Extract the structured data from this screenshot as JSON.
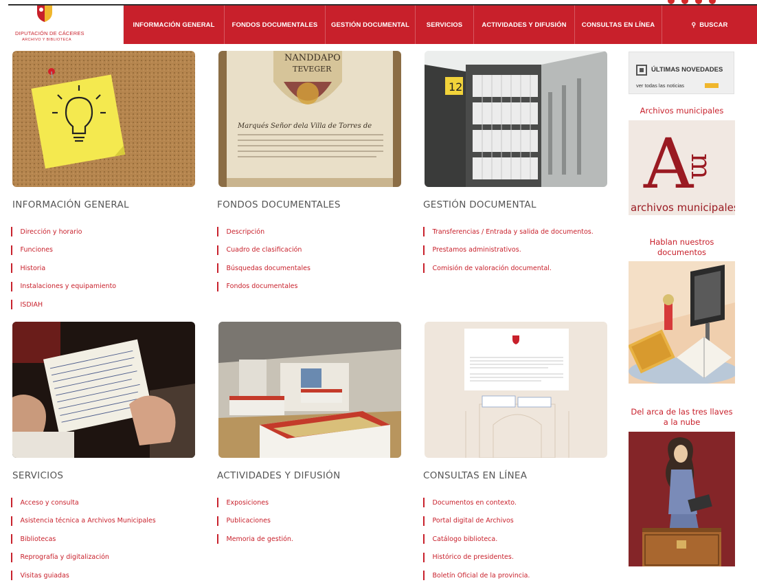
{
  "header": {
    "logo_line1": "DIPUTACIÓN DE CÁCERES",
    "logo_line2": "ARCHIVO Y BIBLIOTECA",
    "nav": [
      {
        "label": "INFORMACIÓN GENERAL",
        "width": 146
      },
      {
        "label": "FONDOS DOCUMENTALES",
        "width": 146
      },
      {
        "label": "GESTIÓN DOCUMENTAL",
        "width": 130
      },
      {
        "label": "SERVICIOS",
        "width": 84
      },
      {
        "label": "ACTIVIDADES Y DIFUSIÓN",
        "width": 146
      },
      {
        "label": "CONSULTAS EN LÍNEA",
        "width": 126
      }
    ],
    "search_label": "BUSCAR",
    "search_icon": "search-icon"
  },
  "sections": {
    "info": {
      "title": "INFORMACIÓN GENERAL",
      "links": [
        "Dirección y horario",
        "Funciones",
        "Historia",
        "Instalaciones y equipamiento",
        "ISDIAH"
      ]
    },
    "fondos": {
      "title": "FONDOS DOCUMENTALES",
      "links": [
        "Descripción",
        "Cuadro de clasificación",
        "Búsquedas documentales",
        "Fondos documentales"
      ]
    },
    "gestion": {
      "title": "GESTIÓN DOCUMENTAL",
      "links": [
        "Transferencias / Entrada y salida de documentos.",
        "Prestamos administrativos.",
        "Comisión de valoración documental."
      ]
    },
    "servicios": {
      "title": "SERVICIOS",
      "links": [
        "Acceso y consulta",
        "Asistencia técnica a Archivos Municipales",
        "Bibliotecas",
        "Reprografía y digitalización",
        "Visitas guiadas"
      ]
    },
    "actividades": {
      "title": "ACTIVIDADES Y DIFUSIÓN",
      "links": [
        "Exposiciones",
        "Publicaciones",
        "Memoria de gestión."
      ]
    },
    "consultas": {
      "title": "CONSULTAS EN LÍNEA",
      "links": [
        "Documentos en contexto.",
        "Portal digital de Archivos",
        "Catálogo biblioteca.",
        "Histórico de presidentes.",
        "Boletín Oficial de la provincia."
      ]
    }
  },
  "images": {
    "info_number": "12",
    "manuscript_heading": "NANDDAPO",
    "manuscript_heading2": "TEVEGER",
    "manuscript_text": "Marqués Señor dela Villa de Torres de"
  },
  "sidebar": {
    "news_title": "ÚLTIMAS NOVEDADES",
    "news_link": "ver todas las noticias",
    "archivos_title": "Archivos municipales",
    "archivos_logo_text": "archivos municipales",
    "hablan_title": "Hablan nuestros documentos",
    "arca_title": "Del arca de las tres llaves a la nube"
  },
  "colors": {
    "brand": "#c8202b",
    "gold": "#f0b62c"
  }
}
